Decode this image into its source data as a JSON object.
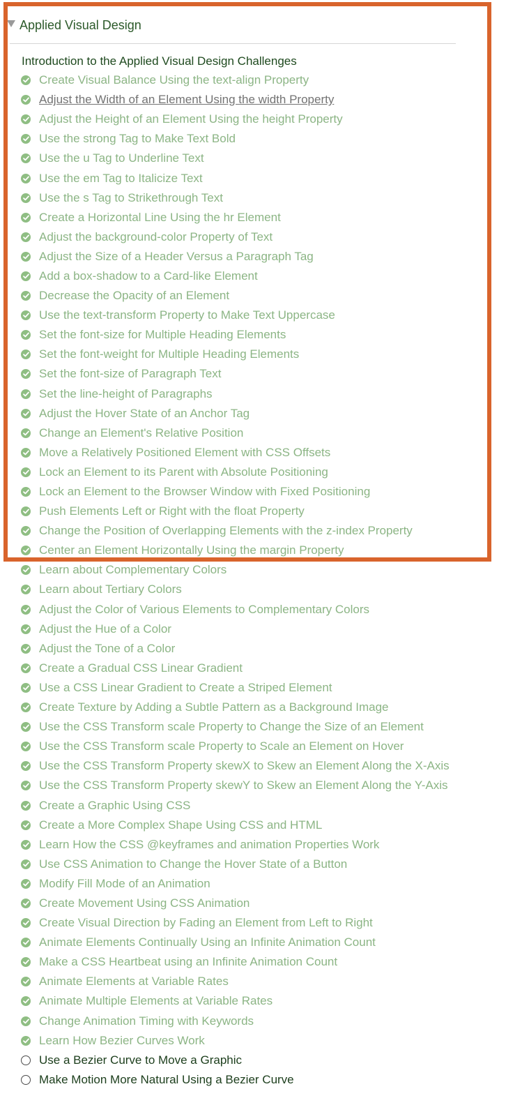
{
  "section": {
    "title": "Applied Visual Design",
    "intro": "Introduction to the Applied Visual Design Challenges"
  },
  "colors": {
    "highlight": "#d9642c",
    "completed": "#8fbe83",
    "text_dark": "#1f4a1f"
  },
  "challenges": [
    {
      "label": "Create Visual Balance Using the text-align Property",
      "completed": true
    },
    {
      "label": "Adjust the Width of an Element Using the width Property",
      "completed": true,
      "hovered": true
    },
    {
      "label": "Adjust the Height of an Element Using the height Property",
      "completed": true
    },
    {
      "label": "Use the strong Tag to Make Text Bold",
      "completed": true
    },
    {
      "label": "Use the u Tag to Underline Text",
      "completed": true
    },
    {
      "label": "Use the em Tag to Italicize Text",
      "completed": true
    },
    {
      "label": "Use the s Tag to Strikethrough Text",
      "completed": true
    },
    {
      "label": "Create a Horizontal Line Using the hr Element",
      "completed": true
    },
    {
      "label": "Adjust the background-color Property of Text",
      "completed": true
    },
    {
      "label": "Adjust the Size of a Header Versus a Paragraph Tag",
      "completed": true
    },
    {
      "label": "Add a box-shadow to a Card-like Element",
      "completed": true
    },
    {
      "label": "Decrease the Opacity of an Element",
      "completed": true
    },
    {
      "label": "Use the text-transform Property to Make Text Uppercase",
      "completed": true
    },
    {
      "label": "Set the font-size for Multiple Heading Elements",
      "completed": true
    },
    {
      "label": "Set the font-weight for Multiple Heading Elements",
      "completed": true
    },
    {
      "label": "Set the font-size of Paragraph Text",
      "completed": true
    },
    {
      "label": "Set the line-height of Paragraphs",
      "completed": true
    },
    {
      "label": "Adjust the Hover State of an Anchor Tag",
      "completed": true
    },
    {
      "label": "Change an Element's Relative Position",
      "completed": true
    },
    {
      "label": "Move a Relatively Positioned Element with CSS Offsets",
      "completed": true
    },
    {
      "label": "Lock an Element to its Parent with Absolute Positioning",
      "completed": true
    },
    {
      "label": "Lock an Element to the Browser Window with Fixed Positioning",
      "completed": true
    },
    {
      "label": "Push Elements Left or Right with the float Property",
      "completed": true
    },
    {
      "label": "Change the Position of Overlapping Elements with the z-index Property",
      "completed": true
    },
    {
      "label": "Center an Element Horizontally Using the margin Property",
      "completed": true
    },
    {
      "label": "Learn about Complementary Colors",
      "completed": true
    },
    {
      "label": "Learn about Tertiary Colors",
      "completed": true
    },
    {
      "label": "Adjust the Color of Various Elements to Complementary Colors",
      "completed": true
    },
    {
      "label": "Adjust the Hue of a Color",
      "completed": true
    },
    {
      "label": "Adjust the Tone of a Color",
      "completed": true
    },
    {
      "label": "Create a Gradual CSS Linear Gradient",
      "completed": true
    },
    {
      "label": "Use a CSS Linear Gradient to Create a Striped Element",
      "completed": true
    },
    {
      "label": "Create Texture by Adding a Subtle Pattern as a Background Image",
      "completed": true
    },
    {
      "label": "Use the CSS Transform scale Property to Change the Size of an Element",
      "completed": true
    },
    {
      "label": "Use the CSS Transform scale Property to Scale an Element on Hover",
      "completed": true
    },
    {
      "label": "Use the CSS Transform Property skewX to Skew an Element Along the X-Axis",
      "completed": true
    },
    {
      "label": "Use the CSS Transform Property skewY to Skew an Element Along the Y-Axis",
      "completed": true
    },
    {
      "label": "Create a Graphic Using CSS",
      "completed": true
    },
    {
      "label": "Create a More Complex Shape Using CSS and HTML",
      "completed": true
    },
    {
      "label": "Learn How the CSS @keyframes and animation Properties Work",
      "completed": true
    },
    {
      "label": "Use CSS Animation to Change the Hover State of a Button",
      "completed": true
    },
    {
      "label": "Modify Fill Mode of an Animation",
      "completed": true
    },
    {
      "label": "Create Movement Using CSS Animation",
      "completed": true
    },
    {
      "label": "Create Visual Direction by Fading an Element from Left to Right",
      "completed": true
    },
    {
      "label": "Animate Elements Continually Using an Infinite Animation Count",
      "completed": true
    },
    {
      "label": "Make a CSS Heartbeat using an Infinite Animation Count",
      "completed": true
    },
    {
      "label": "Animate Elements at Variable Rates",
      "completed": true
    },
    {
      "label": "Animate Multiple Elements at Variable Rates",
      "completed": true
    },
    {
      "label": "Change Animation Timing with Keywords",
      "completed": true
    },
    {
      "label": "Learn How Bezier Curves Work",
      "completed": true
    },
    {
      "label": "Use a Bezier Curve to Move a Graphic",
      "completed": false
    },
    {
      "label": "Make Motion More Natural Using a Bezier Curve",
      "completed": false
    }
  ]
}
